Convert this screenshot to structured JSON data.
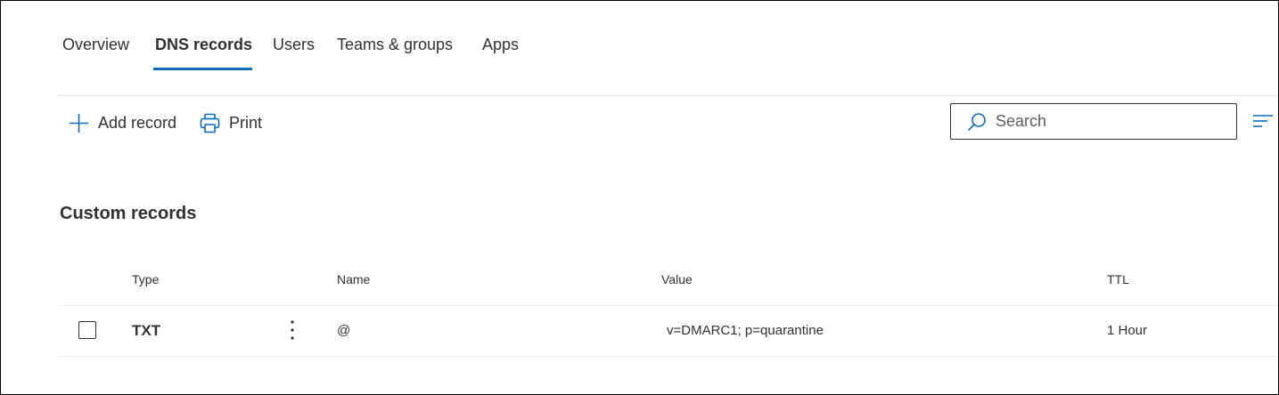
{
  "tabs": [
    {
      "label": "Overview",
      "selected": false
    },
    {
      "label": "DNS records",
      "selected": true
    },
    {
      "label": "Users",
      "selected": false
    },
    {
      "label": "Teams & groups",
      "selected": false
    },
    {
      "label": "Apps",
      "selected": false
    }
  ],
  "toolbar": {
    "add_record": {
      "label": "Add record",
      "icon": "plus-icon"
    },
    "print": {
      "label": "Print",
      "icon": "printer-icon"
    },
    "search": {
      "placeholder": "Search",
      "value": ""
    },
    "filter_icon": "filter-lines-icon"
  },
  "section": {
    "title": "Custom records"
  },
  "table": {
    "headers": {
      "type": "Type",
      "name": "Name",
      "value": "Value",
      "ttl": "TTL"
    },
    "rows": [
      {
        "type": "TXT",
        "name": "@",
        "value": "v=DMARC1; p=quarantine",
        "ttl": "1 Hour",
        "checked": false
      }
    ]
  },
  "colors": {
    "accent": "#0f6cbd",
    "text": "#323130",
    "divider": "#e1dfdd"
  }
}
